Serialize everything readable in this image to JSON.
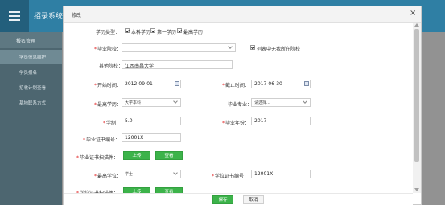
{
  "app": {
    "title": "招录系统",
    "sidebar": {
      "group": "报名管理",
      "items": [
        "学员信息维护",
        "学员报名",
        "招收计划查看",
        "基地联系方式"
      ]
    }
  },
  "modal": {
    "title": "修改",
    "close": "×",
    "education_type": {
      "label": "学历类型：",
      "options": [
        {
          "label": "本科学历",
          "checked": true
        },
        {
          "label": "第一学历",
          "checked": true
        },
        {
          "label": "最高学历",
          "checked": true
        }
      ]
    },
    "school": {
      "label": "毕业院校：",
      "value": "",
      "not_listed_label": "列表中无我所在院校",
      "not_listed_checked": true
    },
    "other_school": {
      "label": "其他院校：",
      "value": "江西南昌大学"
    },
    "start_date": {
      "label": "开始时间：",
      "value": "2012-09-01"
    },
    "end_date": {
      "label": "截止时间：",
      "value": "2017-06-30"
    },
    "degree_level": {
      "label": "最高学历：",
      "value": "大学本科"
    },
    "major": {
      "label": "毕业专业：",
      "value": "请选择..."
    },
    "duration": {
      "label": "学制：",
      "value": "5.0"
    },
    "grad_year": {
      "label": "毕业年份：",
      "value": "2017"
    },
    "cert_no": {
      "label": "毕业证书编号：",
      "value": "12001X"
    },
    "cert_scan": {
      "label": "毕业证书扫描件：",
      "upload": "上传",
      "view": "查看"
    },
    "degree": {
      "label": "最高学位：",
      "value": "学士"
    },
    "degree_cert_no": {
      "label": "学位证书编号：",
      "value": "12001X"
    },
    "degree_scan": {
      "label": "学位证书扫描件：",
      "upload": "上传",
      "view": "查看"
    },
    "footer": {
      "save": "保存",
      "cancel": "取消"
    }
  },
  "colors": {
    "header": "#2f7fa4",
    "sidebar": "#4d6670",
    "green": "#3cb34a",
    "required": "#e02020"
  }
}
